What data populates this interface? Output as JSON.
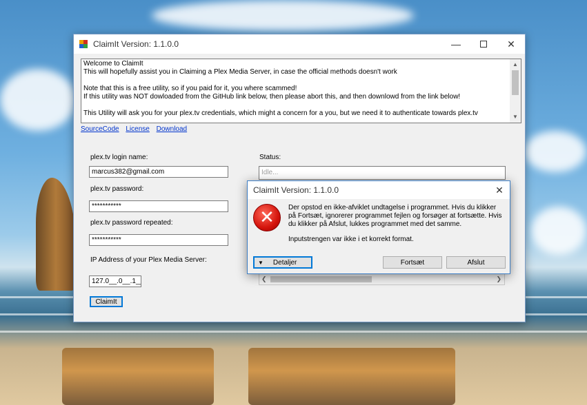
{
  "main_window": {
    "title": "ClaimIt Version: 1.1.0.0",
    "info_lines": [
      "Welcome to ClaimIt",
      "This will hopefully assist you in Claiming a Plex Media Server, in case the official methods doesn't work",
      "",
      "Note that this is a free utility, so if you paid for it, you where scammed!",
      "If this utility was NOT dowloaded from the GitHub link below, then please abort this, and then downlowd from the link below!",
      "",
      "This Utility will ask you for your plex.tv credentials, which might a concern for a you, but we need it to authenticate towards plex.tv"
    ],
    "links": [
      "SourceCode",
      "License",
      "Download"
    ],
    "form": {
      "login_label": "plex.tv login name:",
      "login_value": "marcus382@gmail.com",
      "password_label": "plex.tv password:",
      "password_value": "***********",
      "password_repeat_label": "plex.tv password repeated:",
      "password_repeat_value": "***********",
      "ip_label": "IP Address of your Plex Media Server:",
      "ip_value": "127.0__.0__.1__",
      "claim_button": "ClaimIt"
    },
    "status": {
      "label": "Status:",
      "value": "Idle..."
    }
  },
  "dialog": {
    "title": "ClaimIt Version: 1.1.0.0",
    "message": "Der opstod en ikke-afviklet undtagelse i programmet. Hvis du klikker på Fortsæt, ignorerer programmet fejlen og forsøger at fortsætte. Hvis du klikker på Afslut, lukkes programmet med det samme.",
    "detail_message": "Inputstrengen var ikke i et korrekt format.",
    "details_button": "Detaljer",
    "continue_button": "Fortsæt",
    "quit_button": "Afslut"
  },
  "icons": {
    "app": "claimit-app-icon",
    "error": "error-icon",
    "minimize": "minimize-icon",
    "maximize": "maximize-icon",
    "close": "close-icon"
  },
  "colors": {
    "link": "#0033cc",
    "error_red": "#d4140c",
    "focus_blue": "#0078d7"
  }
}
